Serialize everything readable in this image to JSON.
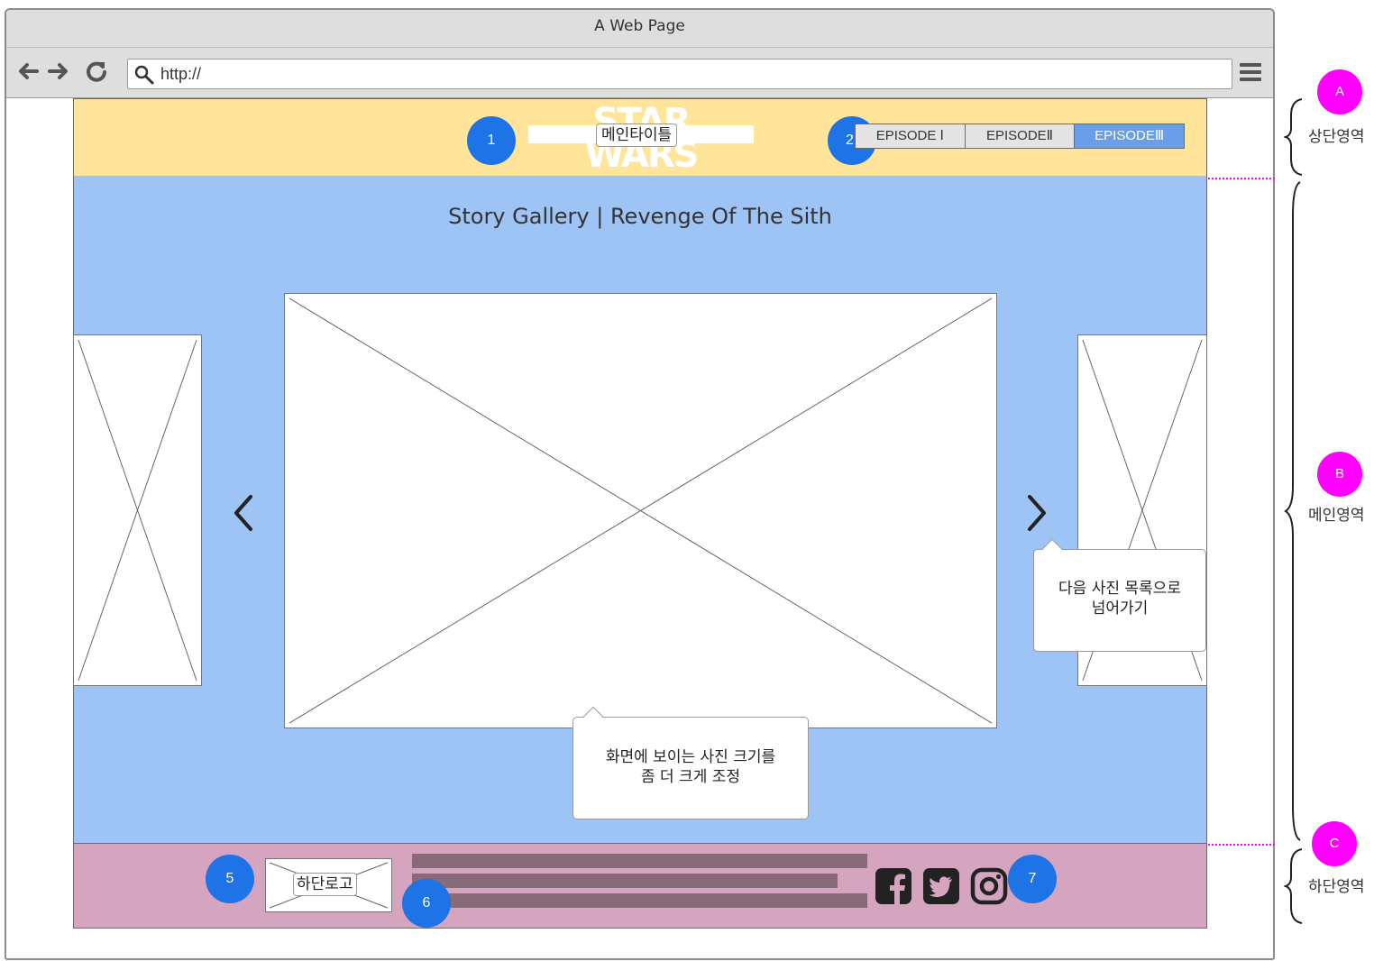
{
  "browser": {
    "window_title": "A Web Page",
    "url": "http://",
    "icons": [
      "back-arrow-icon",
      "forward-arrow-icon",
      "reload-icon",
      "search-icon",
      "hamburger-menu-icon"
    ]
  },
  "header": {
    "logo_text_top": "STAR",
    "logo_text_bottom": "WARS",
    "main_title_label": "메인타이틀",
    "tabs": [
      {
        "label": "EPISODE Ⅰ",
        "active": false
      },
      {
        "label": "EPISODEⅡ",
        "active": false
      },
      {
        "label": "EPISODEⅢ",
        "active": true
      }
    ]
  },
  "main": {
    "gallery_title": "Story Gallery | Revenge Of The Sith",
    "callout_next": "다음 사진 목록으로 넘어가기",
    "callout_next_line1": "다음 사진 목록으로",
    "callout_next_line2": "넘어가기",
    "callout_size_line1": "화면에 보이는 사진 크기를",
    "callout_size_line2": "좀 더 크게 조정"
  },
  "footer": {
    "logo_label": "하단로고",
    "social_icons": [
      "facebook-icon",
      "twitter-icon",
      "instagram-icon"
    ]
  },
  "badges": {
    "b1": "1",
    "b2": "2",
    "b5": "5",
    "b6": "6",
    "b7": "7"
  },
  "regions": {
    "a": {
      "badge": "A",
      "label": "상단영역"
    },
    "b": {
      "badge": "B",
      "label": "메인영역"
    },
    "c": {
      "badge": "C",
      "label": "하단영역"
    }
  },
  "colors": {
    "header_bg": "#ffe59a",
    "main_bg": "#9ec3f5",
    "footer_bg": "#d5a4bf",
    "badge_blue": "#1e73e6",
    "badge_pink": "#ff00ff",
    "tab_active": "#6b9ee8"
  }
}
